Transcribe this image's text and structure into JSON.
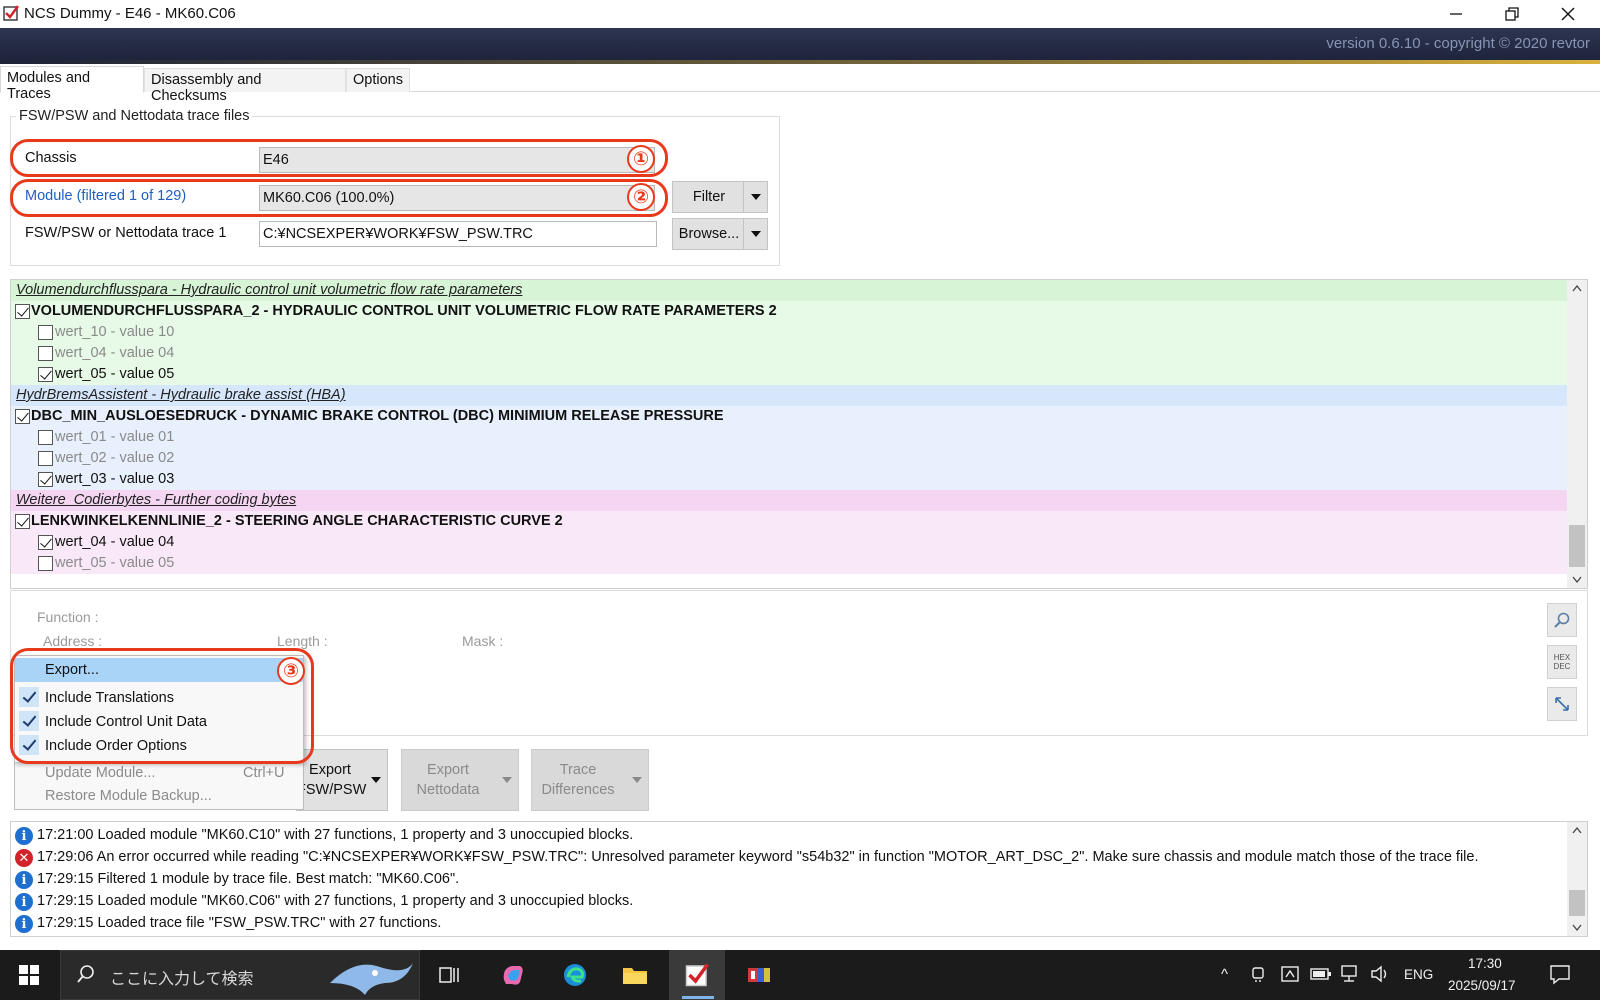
{
  "window": {
    "title": "NCS Dummy - E46 - MK60.C06",
    "version": "version 0.6.10 - copyright © 2020 revtor"
  },
  "tabs": [
    {
      "label": "Modules and Traces",
      "active": true
    },
    {
      "label": "Disassembly and Checksums",
      "active": false
    },
    {
      "label": "Options",
      "active": false
    }
  ],
  "group": {
    "title": "FSW/PSW and Nettodata trace files",
    "chassis_label": "Chassis",
    "chassis_value": "E46",
    "module_label": "Module (filtered 1 of 129)",
    "module_value": "MK60.C06  (100.0%)",
    "trace_label": "FSW/PSW or Nettodata trace 1",
    "trace_value": "C:¥NCSEXPER¥WORK¥FSW_PSW.TRC",
    "filter_label": "Filter",
    "browse_label": "Browse..."
  },
  "annotations": [
    "①",
    "②",
    "③"
  ],
  "tree": {
    "rows": [
      {
        "kind": "group",
        "group": 1,
        "text": "Volumendurchflusspara  -  Hydraulic control unit volumetric flow rate parameters"
      },
      {
        "kind": "function",
        "group": 1,
        "checked": true,
        "text": "VOLUMENDURCHFLUSSPARA_2  -  HYDRAULIC CONTROL UNIT VOLUMETRIC FLOW RATE PARAMETERS 2"
      },
      {
        "kind": "value",
        "group": 1,
        "checked": false,
        "text": "wert_10  -  value 10"
      },
      {
        "kind": "value",
        "group": 1,
        "checked": false,
        "text": "wert_04  -  value 04"
      },
      {
        "kind": "value",
        "group": 1,
        "checked": true,
        "text": "wert_05  -  value 05"
      },
      {
        "kind": "group",
        "group": 2,
        "text": "HydrBremsAssistent  -  Hydraulic brake assist (HBA)"
      },
      {
        "kind": "function",
        "group": 2,
        "checked": true,
        "text": "DBC_MIN_AUSLOESEDRUCK  -  DYNAMIC BRAKE CONTROL (DBC) MINIMIUM RELEASE PRESSURE"
      },
      {
        "kind": "value",
        "group": 2,
        "checked": false,
        "text": "wert_01  -  value 01"
      },
      {
        "kind": "value",
        "group": 2,
        "checked": false,
        "text": "wert_02  -  value 02"
      },
      {
        "kind": "value",
        "group": 2,
        "checked": true,
        "text": "wert_03  -  value 03"
      },
      {
        "kind": "group",
        "group": 3,
        "text": "Weitere_Codierbytes  -  Further coding bytes"
      },
      {
        "kind": "function",
        "group": 3,
        "checked": true,
        "text": "LENKWINKELKENNLINIE_2  -  STEERING ANGLE CHARACTERISTIC CURVE 2"
      },
      {
        "kind": "value",
        "group": 3,
        "checked": true,
        "text": "wert_04  -  value 04"
      },
      {
        "kind": "value",
        "group": 3,
        "checked": false,
        "text": "wert_05  -  value 05"
      }
    ]
  },
  "details": {
    "function_label": "Function :",
    "address_label": "Address :",
    "length_label": "Length :",
    "mask_label": "Mask :",
    "hex_dec": "HEX\nDEC"
  },
  "menu": {
    "export": "Export...",
    "items": [
      {
        "label": "Include Translations",
        "checked": true
      },
      {
        "label": "Include Control Unit Data",
        "checked": true
      },
      {
        "label": "Include Order Options",
        "checked": true
      }
    ],
    "update": "Update Module...",
    "update_shortcut": "Ctrl+U",
    "restore": "Restore Module Backup..."
  },
  "buttons": {
    "export_fsw_l1": "Export",
    "export_fsw_l2": "FSW/PSW",
    "export_netto_l1": "Export",
    "export_netto_l2": "Nettodata",
    "trace_diff_l1": "Trace",
    "trace_diff_l2": "Differences"
  },
  "log": [
    {
      "type": "info",
      "text": "17:21:00  Loaded module \"MK60.C10\" with 27 functions, 1 property and 3 unoccupied blocks."
    },
    {
      "type": "error",
      "text": "17:29:06  An error occurred while reading \"C:¥NCSEXPER¥WORK¥FSW_PSW.TRC\": Unresolved parameter keyword \"s54b32\" in function \"MOTOR_ART_DSC_2\". Make sure chassis and module match those of the trace file."
    },
    {
      "type": "info",
      "text": "17:29:15  Filtered 1 module by trace file. Best match: \"MK60.C06\"."
    },
    {
      "type": "info",
      "text": "17:29:15  Loaded module \"MK60.C06\" with 27 functions, 1 property and 3 unoccupied blocks."
    },
    {
      "type": "info",
      "text": "17:29:15  Loaded trace file \"FSW_PSW.TRC\" with 27 functions."
    }
  ],
  "taskbar": {
    "search_placeholder": "ここに入力して検索",
    "lang": "ENG",
    "time": "17:30",
    "date": "2025/09/17"
  },
  "colors": {
    "accent_link": "#1f5fbf",
    "annotation": "#e8391d",
    "group1": "#e7f9e7",
    "group2": "#e7f0fc",
    "group3": "#f9e8f8"
  }
}
